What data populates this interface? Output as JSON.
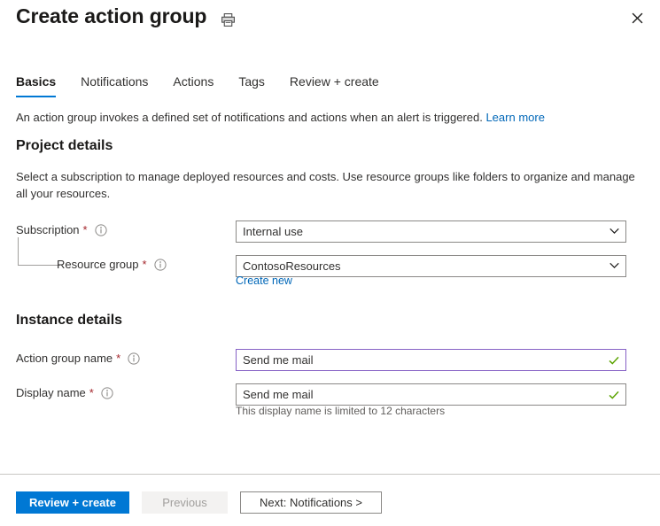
{
  "header": {
    "title": "Create action group",
    "print_icon": "printer-icon",
    "close_icon": "close-icon"
  },
  "tabs": [
    {
      "label": "Basics",
      "active": true
    },
    {
      "label": "Notifications",
      "active": false
    },
    {
      "label": "Actions",
      "active": false
    },
    {
      "label": "Tags",
      "active": false
    },
    {
      "label": "Review + create",
      "active": false
    }
  ],
  "intro": {
    "text": "An action group invokes a defined set of notifications and actions when an alert is triggered.",
    "link_label": "Learn more"
  },
  "project_details": {
    "heading": "Project details",
    "description": "Select a subscription to manage deployed resources and costs. Use resource groups like folders to organize and manage all your resources.",
    "subscription": {
      "label": "Subscription",
      "required_marker": "*",
      "info_icon": "info-icon",
      "value": "Internal use",
      "chevron_icon": "chevron-down-icon"
    },
    "resource_group": {
      "label": "Resource group",
      "required_marker": "*",
      "info_icon": "info-icon",
      "value": "ContosoResources",
      "chevron_icon": "chevron-down-icon",
      "create_new_label": "Create new"
    }
  },
  "instance_details": {
    "heading": "Instance details",
    "action_group_name": {
      "label": "Action group name",
      "required_marker": "*",
      "info_icon": "info-icon",
      "value": "Send me mail",
      "placeholder": "",
      "validation_icon": "check-icon",
      "focused": true
    },
    "display_name": {
      "label": "Display name",
      "required_marker": "*",
      "info_icon": "info-icon",
      "value": "Send me mail",
      "placeholder": "",
      "validation_icon": "check-icon",
      "hint": "This display name is limited to 12 characters"
    }
  },
  "footer": {
    "review_create_label": "Review + create",
    "previous_label": "Previous",
    "next_label": "Next: Notifications >"
  },
  "colors": {
    "accent": "#0078d4",
    "link": "#0067b8",
    "required": "#a4262c",
    "focus_border": "#8661c5",
    "valid_check": "#5ba300",
    "border": "#8a8886",
    "disabled_bg": "#f3f2f1",
    "disabled_text": "#a19f9d"
  }
}
